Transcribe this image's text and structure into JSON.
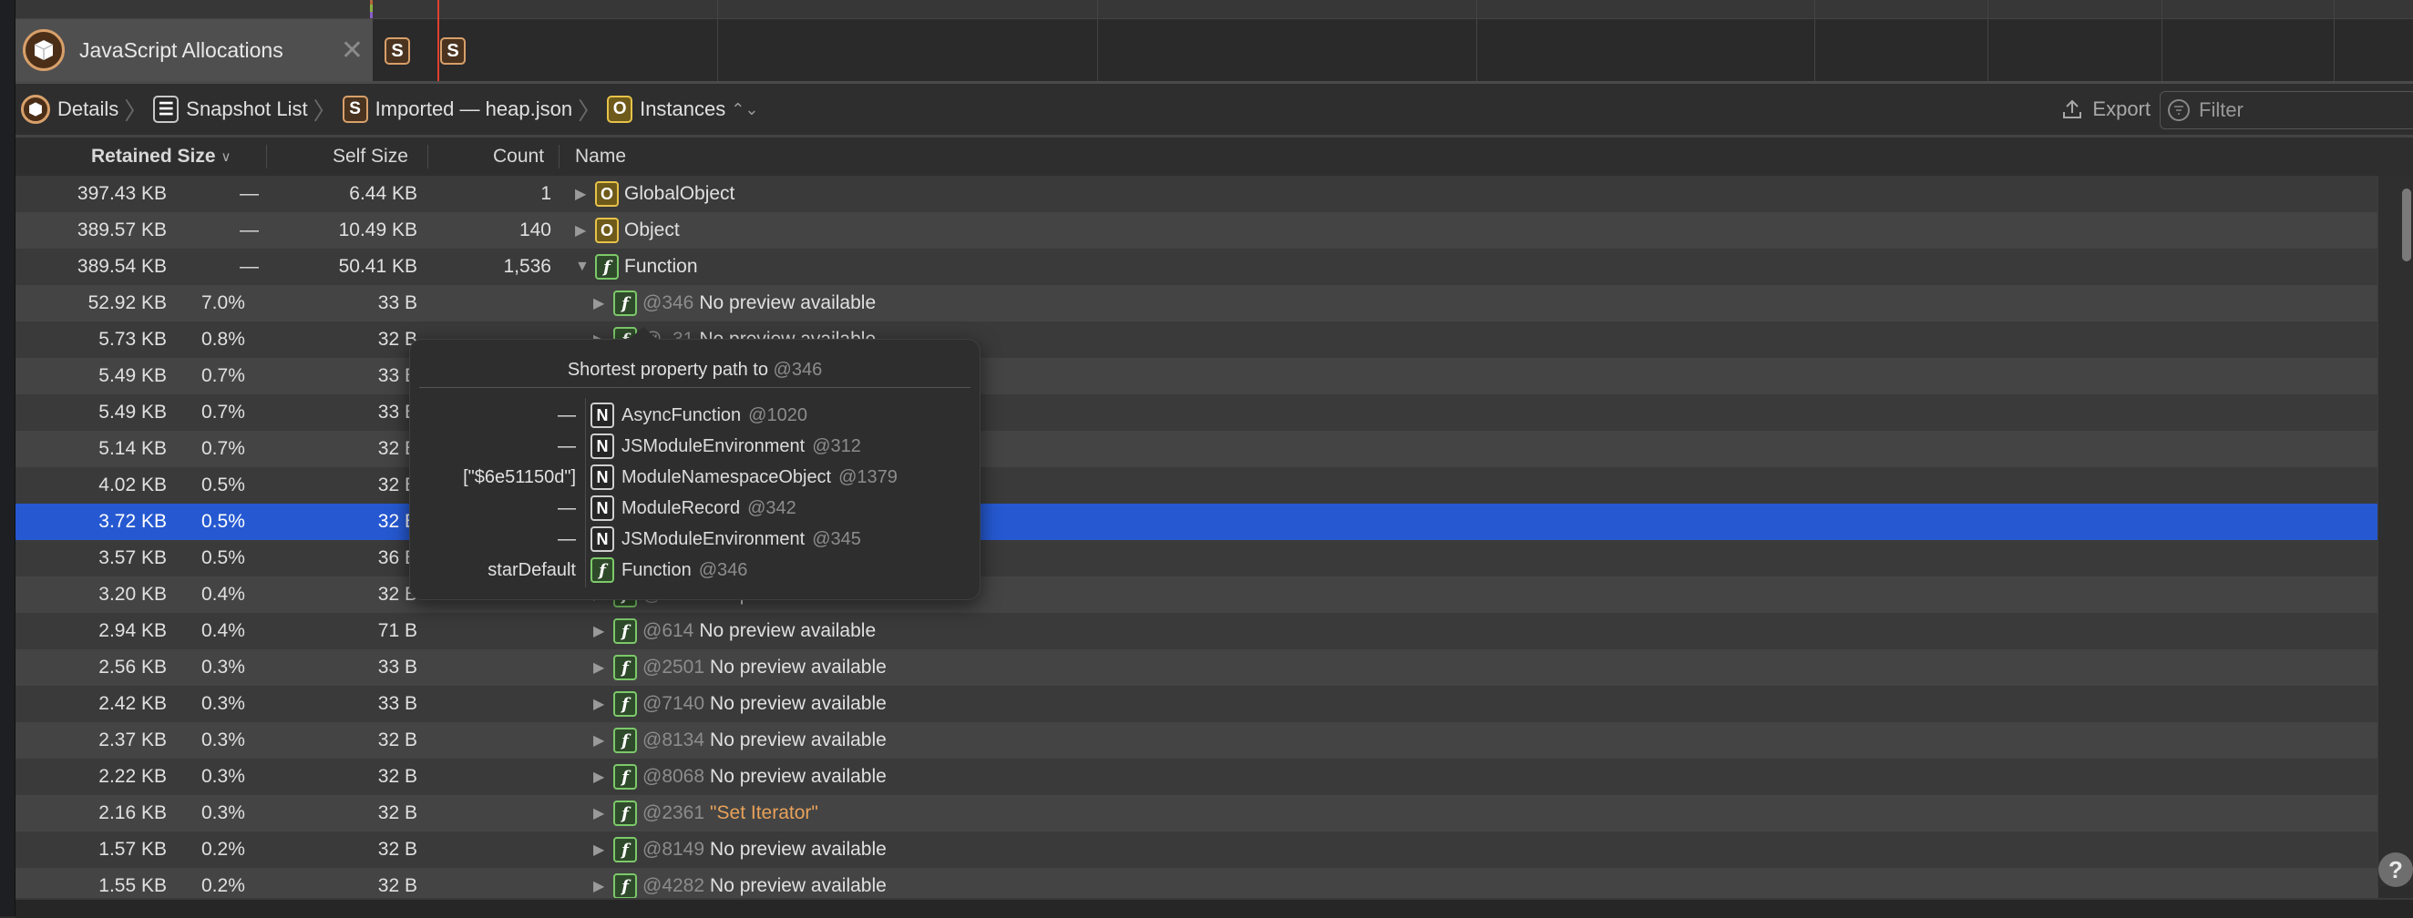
{
  "tab": {
    "label": "JavaScript Allocations",
    "close_icon": "close-icon"
  },
  "timeline": {
    "markers": [
      "S",
      "S"
    ]
  },
  "breadcrumb": {
    "items": [
      {
        "icon": "allocations-icon",
        "label": "Details"
      },
      {
        "icon": "list-icon",
        "label": "Snapshot List"
      },
      {
        "icon": "S",
        "label": "Imported — heap.json"
      },
      {
        "icon": "O",
        "label": "Instances"
      }
    ]
  },
  "toolbar": {
    "export_label": "Export",
    "filter_placeholder": "Filter"
  },
  "table": {
    "columns": {
      "retained": "Retained Size",
      "self": "Self Size",
      "count": "Count",
      "name": "Name"
    },
    "rows": [
      {
        "retained": "397.43 KB",
        "pct": "—",
        "self": "6.44 KB",
        "count": "1",
        "icon": "O",
        "expanded": false,
        "name": "GlobalObject",
        "level": 0
      },
      {
        "retained": "389.57 KB",
        "pct": "—",
        "self": "10.49 KB",
        "count": "140",
        "icon": "O",
        "expanded": false,
        "name": "Object",
        "level": 0
      },
      {
        "retained": "389.54 KB",
        "pct": "—",
        "self": "50.41 KB",
        "count": "1,536",
        "icon": "f",
        "expanded": true,
        "name": "Function",
        "level": 0
      },
      {
        "retained": "52.92 KB",
        "pct": "7.0%",
        "self": "33 B",
        "icon": "f",
        "id": "@346",
        "preview": "No preview available",
        "level": 1
      },
      {
        "retained": "5.73 KB",
        "pct": "0.8%",
        "self": "32 B",
        "icon": "f",
        "id": "@..31",
        "preview": "No preview available",
        "level": 1
      },
      {
        "retained": "5.49 KB",
        "pct": "0.7%",
        "self": "33 B",
        "icon": "f",
        "id": "",
        "preview": "",
        "level": 1
      },
      {
        "retained": "5.49 KB",
        "pct": "0.7%",
        "self": "33 B",
        "icon": "f",
        "id": "",
        "preview": "",
        "level": 1
      },
      {
        "retained": "5.14 KB",
        "pct": "0.7%",
        "self": "32 B",
        "icon": "f",
        "id": "",
        "preview": "",
        "level": 1
      },
      {
        "retained": "4.02 KB",
        "pct": "0.5%",
        "self": "32 B",
        "icon": "f",
        "id": "",
        "preview": "",
        "level": 1
      },
      {
        "retained": "3.72 KB",
        "pct": "0.5%",
        "self": "32 B",
        "icon": "f",
        "id": "",
        "preview": "",
        "level": 1,
        "selected": true
      },
      {
        "retained": "3.57 KB",
        "pct": "0.5%",
        "self": "36 B",
        "icon": "f",
        "id": "",
        "preview": "",
        "level": 1
      },
      {
        "retained": "3.20 KB",
        "pct": "0.4%",
        "self": "32 B",
        "icon": "f",
        "id": "@2339",
        "preview": "No preview available",
        "level": 1
      },
      {
        "retained": "2.94 KB",
        "pct": "0.4%",
        "self": "71 B",
        "icon": "f",
        "id": "@614",
        "preview": "No preview available",
        "level": 1
      },
      {
        "retained": "2.56 KB",
        "pct": "0.3%",
        "self": "33 B",
        "icon": "f",
        "id": "@2501",
        "preview": "No preview available",
        "level": 1
      },
      {
        "retained": "2.42 KB",
        "pct": "0.3%",
        "self": "33 B",
        "icon": "f",
        "id": "@7140",
        "preview": "No preview available",
        "level": 1
      },
      {
        "retained": "2.37 KB",
        "pct": "0.3%",
        "self": "32 B",
        "icon": "f",
        "id": "@8134",
        "preview": "No preview available",
        "level": 1
      },
      {
        "retained": "2.22 KB",
        "pct": "0.3%",
        "self": "32 B",
        "icon": "f",
        "id": "@8068",
        "preview": "No preview available",
        "level": 1
      },
      {
        "retained": "2.16 KB",
        "pct": "0.3%",
        "self": "32 B",
        "icon": "f",
        "id": "@2361",
        "string": "\"Set Iterator\"",
        "level": 1
      },
      {
        "retained": "1.57 KB",
        "pct": "0.2%",
        "self": "32 B",
        "icon": "f",
        "id": "@8149",
        "preview": "No preview available",
        "level": 1
      },
      {
        "retained": "1.55 KB",
        "pct": "0.2%",
        "self": "32 B",
        "icon": "f",
        "id": "@4282",
        "preview": "No preview available",
        "level": 1
      }
    ]
  },
  "popover": {
    "title": "Shortest property path to",
    "title_id": "@346",
    "path": [
      {
        "edge": "—",
        "icon": "N",
        "name": "AsyncFunction",
        "id": "@1020"
      },
      {
        "edge": "—",
        "icon": "N",
        "name": "JSModuleEnvironment",
        "id": "@312"
      },
      {
        "edge": "[\"$6e51150d\"]",
        "icon": "N",
        "name": "ModuleNamespaceObject",
        "id": "@1379"
      },
      {
        "edge": "—",
        "icon": "N",
        "name": "ModuleRecord",
        "id": "@342"
      },
      {
        "edge": "—",
        "icon": "N",
        "name": "JSModuleEnvironment",
        "id": "@345"
      },
      {
        "edge": "starDefault",
        "icon": "f",
        "name": "Function",
        "id": "@346"
      }
    ]
  },
  "help": {
    "label": "?"
  },
  "colors": {
    "selection": "#2659d1",
    "string": "#e8a25a",
    "object_icon": "#e6c24a",
    "function_icon": "#7cc96a",
    "snapshot_icon": "#d8a06a",
    "playhead": "#e0412f"
  }
}
